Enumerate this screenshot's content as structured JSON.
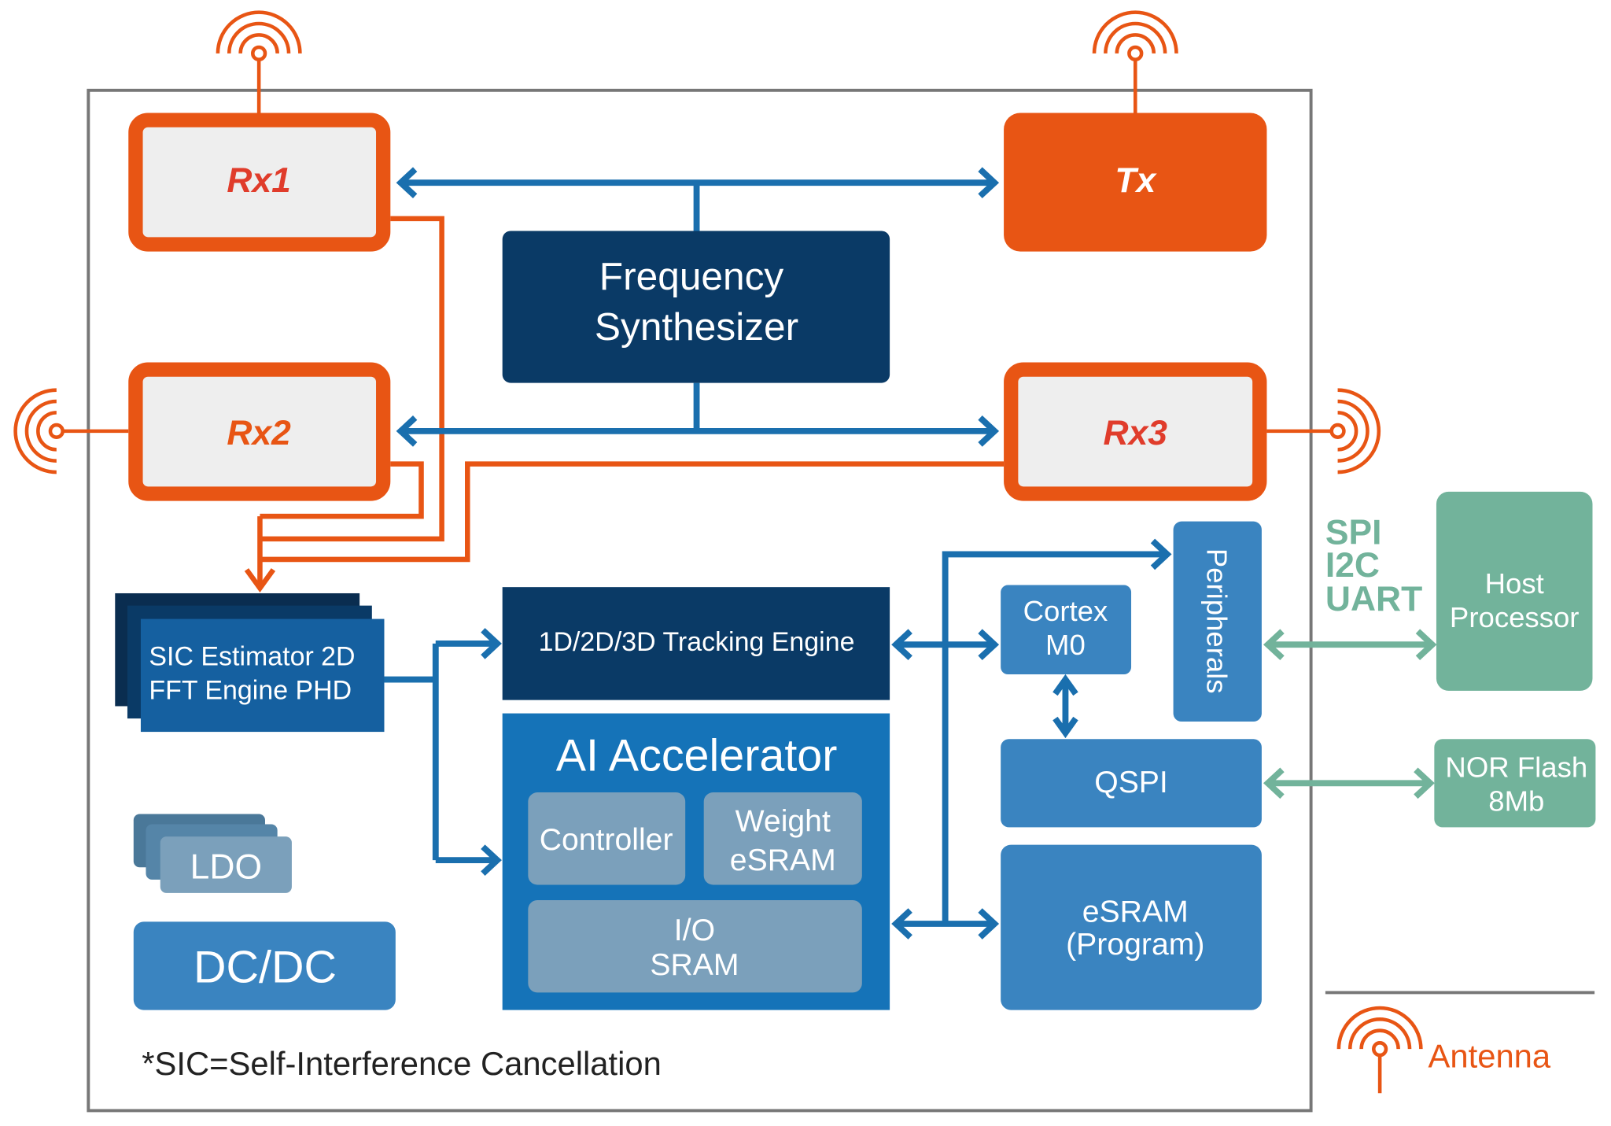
{
  "colors": {
    "orange": "#e85514",
    "rx_text_red": "#e03c2b",
    "navy": "#0a3a66",
    "blue_line": "#1a6fae",
    "mid_blue": "#3a84c0",
    "ai_blue": "#1573b8",
    "gray_blue": "#7ba0bb",
    "green": "#72b39b",
    "border_gray": "#777777"
  },
  "rf": {
    "rx1": "Rx1",
    "rx2": "Rx2",
    "rx3": "Rx3",
    "tx": "Tx",
    "freq_synth_line1": "Frequency",
    "freq_synth_line2": "Synthesizer"
  },
  "dsp": {
    "sic_line1": "SIC Estimator 2D",
    "sic_line2": "FFT Engine PHD",
    "tracking": "1D/2D/3D Tracking Engine"
  },
  "ai": {
    "title": "AI Accelerator",
    "controller": "Controller",
    "weight_line1": "Weight",
    "weight_line2": "eSRAM",
    "io_line1": "I/O",
    "io_line2": "SRAM"
  },
  "mcu": {
    "cortex_line1": "Cortex",
    "cortex_line2": "M0",
    "peripherals": "Peripherals",
    "qspi": "QSPI",
    "esram_line1": "eSRAM",
    "esram_line2": "(Program)"
  },
  "power": {
    "ldo": "LDO",
    "dcdc": "DC/DC"
  },
  "external": {
    "interfaces": [
      "SPI",
      "I2C",
      "UART"
    ],
    "host_line1": "Host",
    "host_line2": "Processor",
    "nor_line1": "NOR Flash",
    "nor_line2": "8Mb"
  },
  "footnote": "*SIC=Self-Interference Cancellation",
  "legend": {
    "icon": "antenna-icon",
    "label": "Antenna"
  }
}
